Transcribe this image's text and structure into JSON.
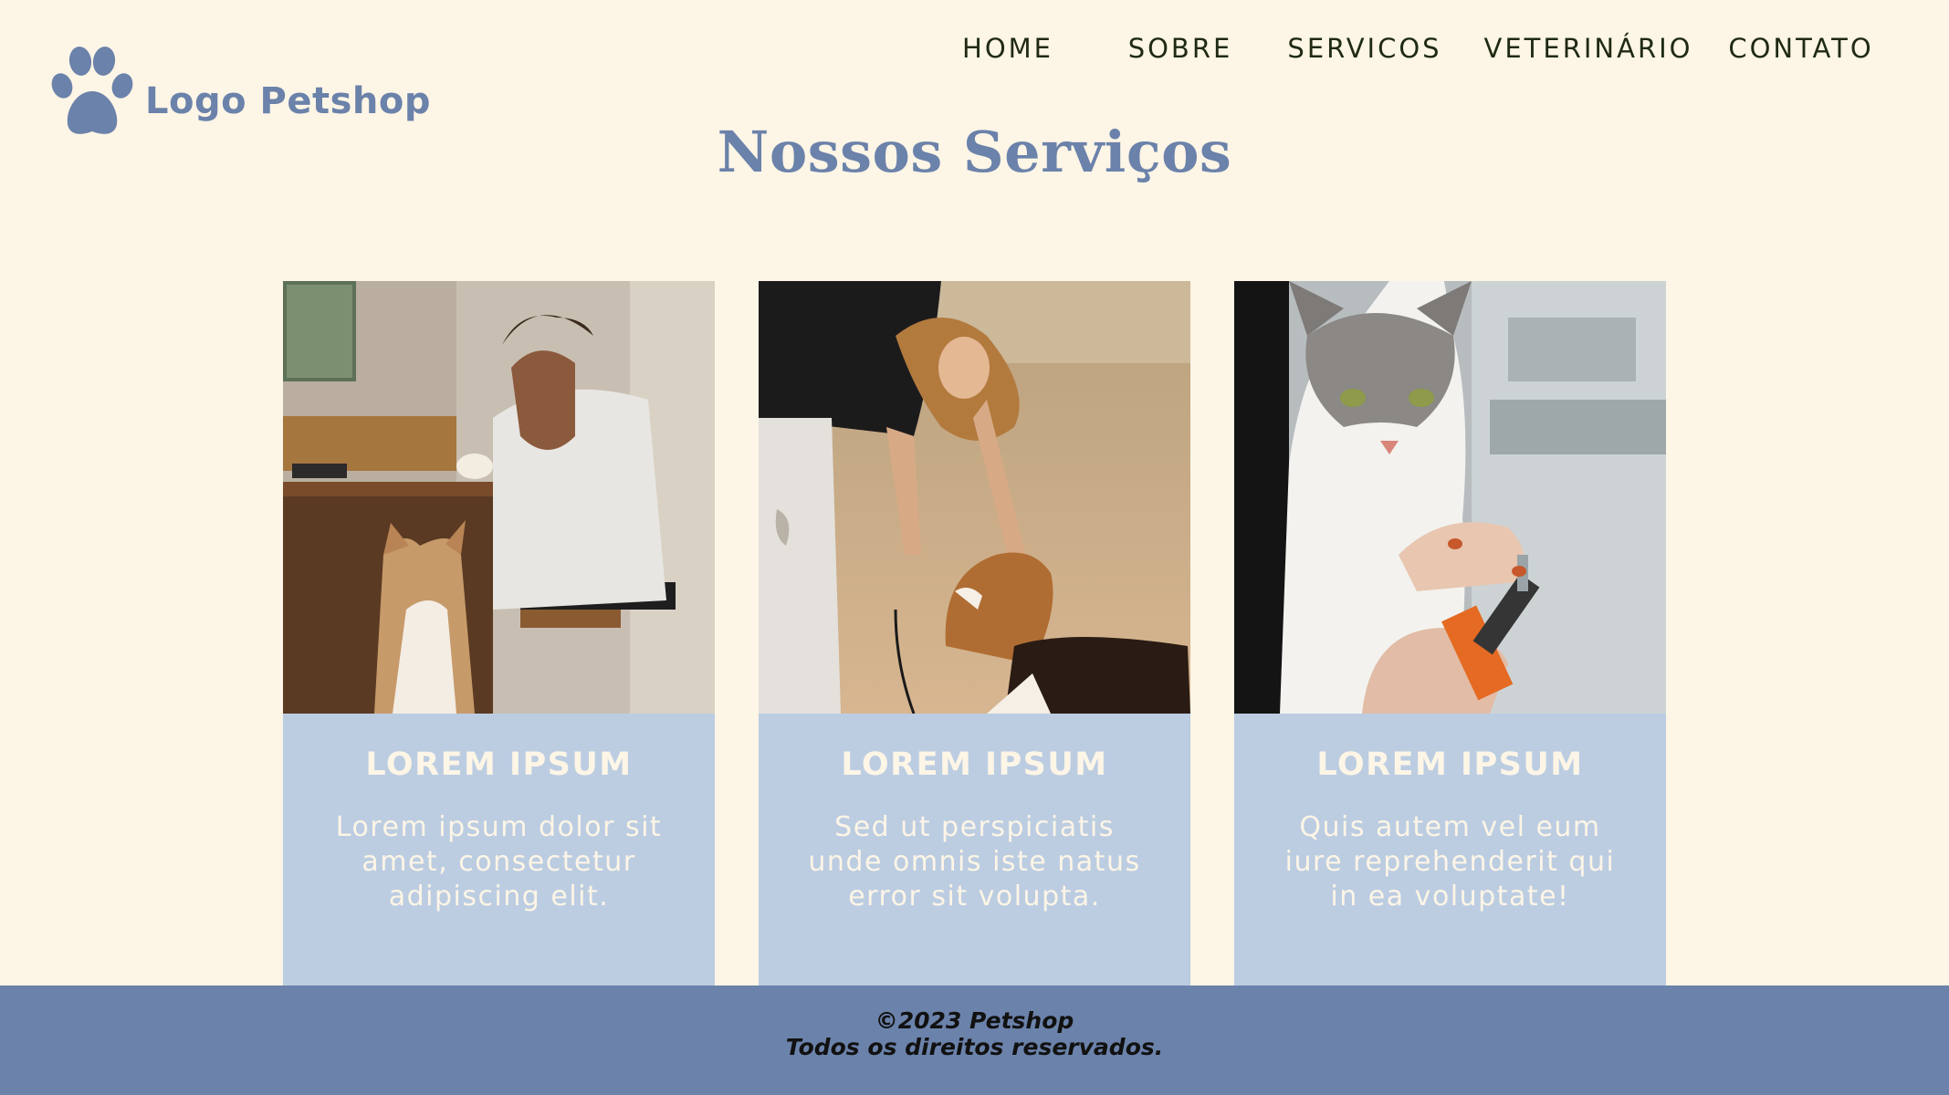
{
  "brand": {
    "logo_text": "Logo Petshop",
    "color": "#6b82aa"
  },
  "nav": {
    "items": [
      {
        "label": "HOME"
      },
      {
        "label": "SOBRE"
      },
      {
        "label": "SERVICOS"
      },
      {
        "label": "VETERINÁRIO"
      },
      {
        "label": "CONTATO"
      }
    ]
  },
  "page": {
    "title": "Nossos Serviços"
  },
  "cards": [
    {
      "image": "man-with-dog-photo",
      "title": "LOREM IPSUM",
      "text": "Lorem ipsum dolor sit amet, consectetur adipiscing elit."
    },
    {
      "image": "woman-with-beagle-photo",
      "title": "LOREM IPSUM",
      "text": "Sed ut perspiciatis unde omnis iste natus error sit volupta."
    },
    {
      "image": "cat-nail-trim-photo",
      "title": "LOREM IPSUM",
      "text": "Quis autem vel eum iure reprehenderit qui in ea voluptate!"
    }
  ],
  "footer": {
    "copyright": "©2023 Petshop",
    "rights": "Todos os direitos reservados."
  },
  "colors": {
    "background": "#fdf5e6",
    "accent": "#6b82aa",
    "card": "#bccde2",
    "nav_text": "#1f2a12"
  }
}
